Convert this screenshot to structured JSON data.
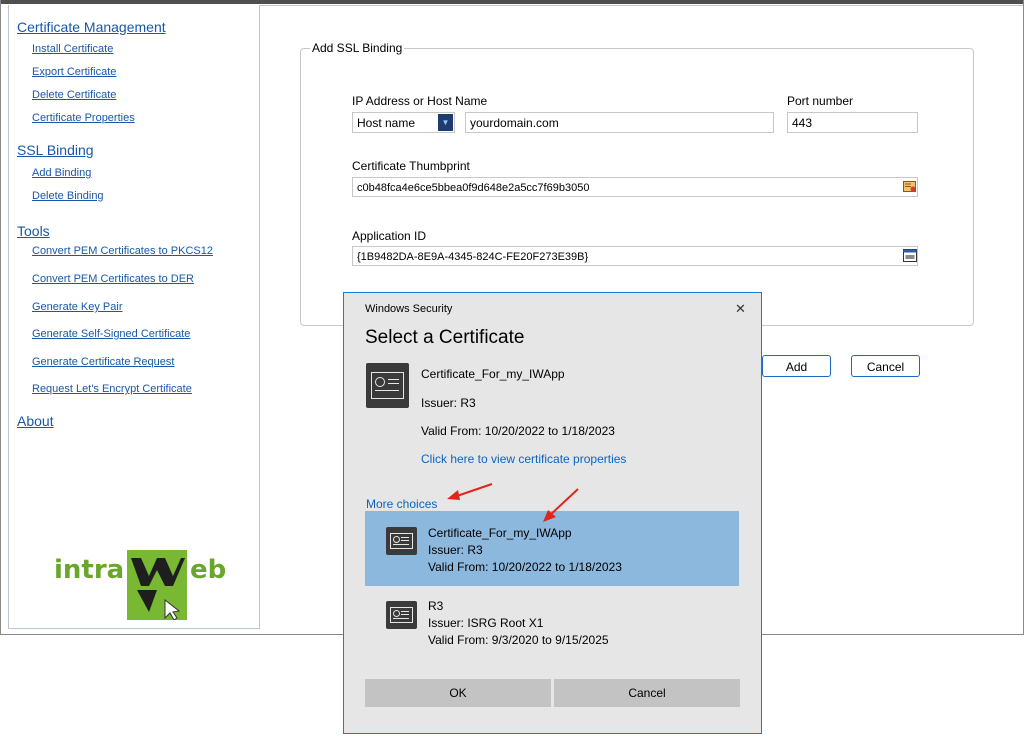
{
  "sidebar": {
    "sections": [
      {
        "title": "Certificate Management",
        "items": [
          "Install Certificate",
          "Export Certificate",
          "Delete Certificate",
          "Certificate Properties"
        ]
      },
      {
        "title": "SSL Binding",
        "items": [
          "Add Binding",
          "Delete Binding"
        ]
      },
      {
        "title": "Tools",
        "items": [
          "Convert PEM Certificates to PKCS12",
          "Convert PEM Certificates to DER",
          "Generate Key Pair",
          "Generate Self-Signed Certificate",
          "Generate Certificate Request",
          "Request Let's Encrypt Certificate"
        ]
      },
      {
        "title": "About",
        "items": []
      }
    ],
    "logo": {
      "left": "intra",
      "right": "eb"
    }
  },
  "form": {
    "legend": "Add SSL Binding",
    "ip_label": "IP Address or Host Name",
    "host_type": "Host name",
    "host_value": "yourdomain.com",
    "port_label": "Port number",
    "port_value": "443",
    "thumb_label": "Certificate Thumbprint",
    "thumb_value": "c0b48fca4e6ce5bbea0f9d648e2a5cc7f69b3050",
    "appid_label": "Application ID",
    "appid_value": "{1B9482DA-8E9A-4345-824C-FE20F273E39B}",
    "add_label": "Add",
    "cancel_label": "Cancel"
  },
  "dialog": {
    "window_title": "Windows Security",
    "close": "✕",
    "heading": "Select a Certificate",
    "main_cert": {
      "name": "Certificate_For_my_IWApp",
      "issuer": "Issuer: R3",
      "valid": "Valid From: 10/20/2022 to 1/18/2023",
      "properties_link": "Click here to view certificate properties"
    },
    "more_choices": "More choices",
    "choices": [
      {
        "name": "Certificate_For_my_IWApp",
        "issuer": "Issuer: R3",
        "valid": "Valid From: 10/20/2022 to 1/18/2023"
      },
      {
        "name": "R3",
        "issuer": "Issuer: ISRG Root X1",
        "valid": "Valid From: 9/3/2020 to 9/15/2025"
      }
    ],
    "ok_label": "OK",
    "cancel_label": "Cancel"
  },
  "colors": {
    "link": "#1a57a8",
    "selected_row": "#8cb8de",
    "annotation_arrow": "#e3241b",
    "logo_green": "#78b833"
  }
}
